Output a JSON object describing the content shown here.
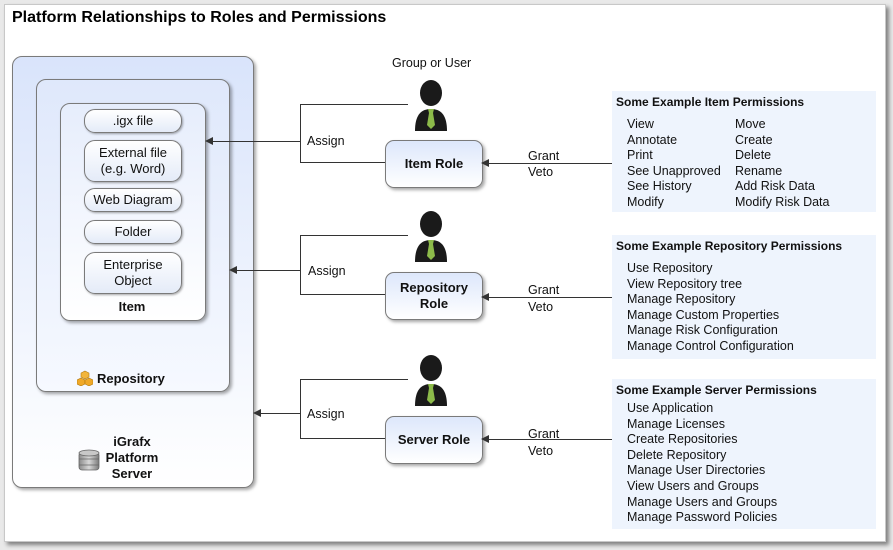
{
  "title": "Platform Relationships to Roles and Permissions",
  "colors": {
    "container_gradient_top": "#d9e4fb",
    "panel_bg": "#eef4fd",
    "tie": "#8dbb4a",
    "person": "#1a1a1a",
    "line": "#333333"
  },
  "containers": {
    "server": {
      "label_lines": [
        "iGrafx",
        "Platform",
        "Server"
      ],
      "icon": "database-icon"
    },
    "repository": {
      "label": "Repository",
      "icon": "cubes-icon"
    },
    "item": {
      "label": "Item"
    }
  },
  "item_types": [
    {
      "lines": [
        ".igx file"
      ]
    },
    {
      "lines": [
        "External file",
        "(e.g. Word)"
      ]
    },
    {
      "lines": [
        "Web Diagram"
      ]
    },
    {
      "lines": [
        "Folder"
      ]
    },
    {
      "lines": [
        "Enterprise",
        "Object"
      ]
    }
  ],
  "group_or_user_label": "Group or User",
  "roles": [
    {
      "lines": [
        "Item Role"
      ],
      "assign_label": "Assign",
      "grant_label": "Grant",
      "veto_label": "Veto"
    },
    {
      "lines": [
        "Repository",
        "Role"
      ],
      "assign_label": "Assign",
      "grant_label": "Grant",
      "veto_label": "Veto"
    },
    {
      "lines": [
        "Server Role"
      ],
      "assign_label": "Assign",
      "grant_label": "Grant",
      "veto_label": "Veto"
    }
  ],
  "permission_panels": [
    {
      "title": "Some Example Item Permissions",
      "columns": [
        [
          "View",
          "Annotate",
          "Print",
          "See Unapproved",
          "See History",
          "Modify"
        ],
        [
          "Move",
          "Create",
          "Delete",
          "Rename",
          "Add Risk Data",
          "Modify Risk Data"
        ]
      ]
    },
    {
      "title": "Some Example Repository Permissions",
      "columns": [
        [
          "Use Repository",
          "View Repository tree",
          "Manage Repository",
          "Manage Custom Properties",
          "Manage Risk Configuration",
          "Manage Control Configuration"
        ]
      ]
    },
    {
      "title": "Some Example Server Permissions",
      "columns": [
        [
          "Use Application",
          "Manage Licenses",
          "Create Repositories",
          "Delete Repository",
          "Manage User Directories",
          "View Users and Groups",
          "Manage Users and Groups",
          "Manage Password Policies"
        ]
      ]
    }
  ]
}
